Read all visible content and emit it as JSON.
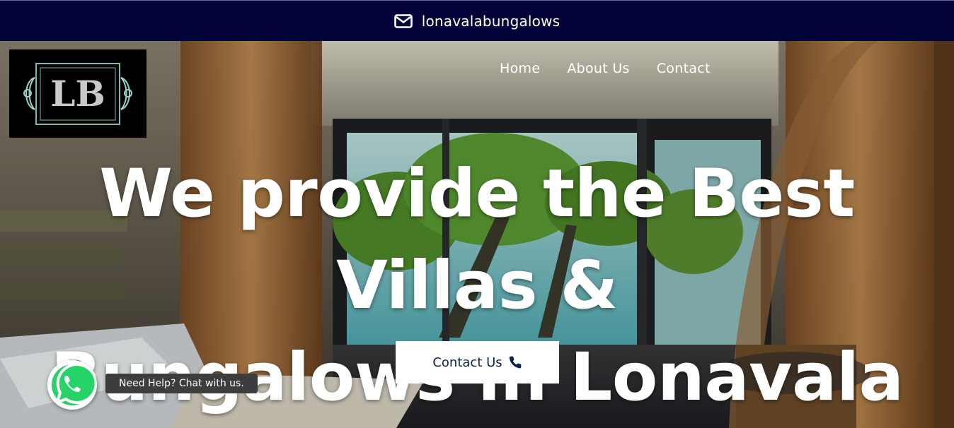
{
  "topbar": {
    "email": "lonavalabungalows",
    "icon": "envelope-icon"
  },
  "logo": {
    "text": "LB"
  },
  "nav": {
    "items": [
      "Home",
      "About Us",
      "Contact"
    ]
  },
  "hero": {
    "headline_line1": "We provide the Best Villas &",
    "headline_line2": "Bungalows in Lonavala",
    "cta_label": "Contact Us",
    "cta_icon": "phone-icon"
  },
  "whatsapp": {
    "tooltip": "Need Help? Chat with us.",
    "icon": "whatsapp-icon",
    "color": "#25d366"
  },
  "colors": {
    "topbar": "#020338",
    "cta_text": "#0d2148"
  }
}
